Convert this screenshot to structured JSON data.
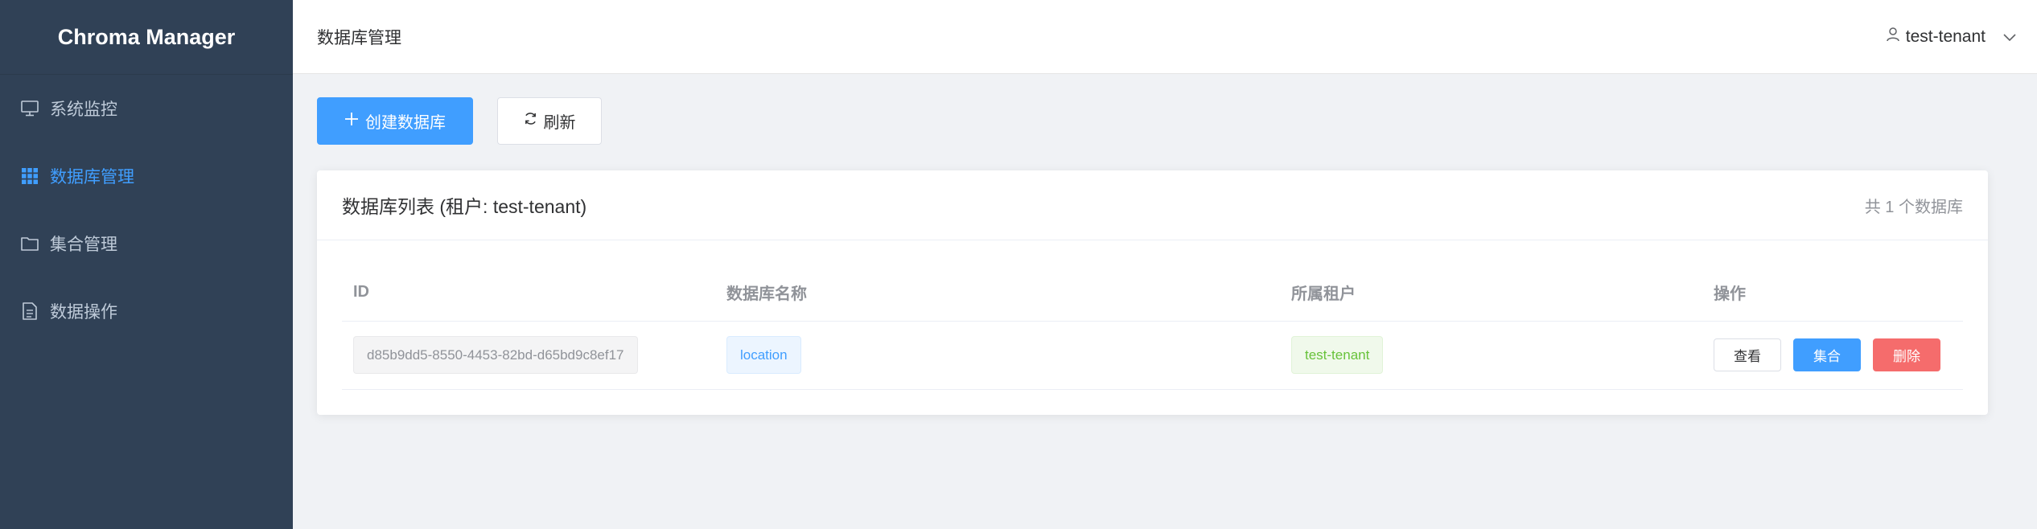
{
  "sidebar": {
    "brand": "Chroma Manager",
    "items": [
      {
        "label": "系统监控",
        "icon": "monitor-icon",
        "active": false
      },
      {
        "label": "数据库管理",
        "icon": "grid-icon",
        "active": true
      },
      {
        "label": "集合管理",
        "icon": "folder-icon",
        "active": false
      },
      {
        "label": "数据操作",
        "icon": "document-icon",
        "active": false
      }
    ]
  },
  "header": {
    "title": "数据库管理",
    "user": "test-tenant",
    "user_icon": "user-icon",
    "dropdown_icon": "chevron-down-icon"
  },
  "toolbar": {
    "create_label": "创建数据库",
    "create_icon": "plus-icon",
    "refresh_label": "刷新",
    "refresh_icon": "refresh-icon"
  },
  "card": {
    "title": "数据库列表 (租户: test-tenant)",
    "count": "共 1 个数据库"
  },
  "table": {
    "columns": [
      "ID",
      "数据库名称",
      "所属租户",
      "操作"
    ],
    "rows": [
      {
        "id": "d85b9dd5-8550-4453-82bd-d65bd9c8ef17",
        "name": "location",
        "tenant": "test-tenant",
        "actions": {
          "view": "查看",
          "collections": "集合",
          "delete": "删除"
        }
      }
    ]
  },
  "colors": {
    "sidebar_bg": "#304156",
    "accent": "#409eff",
    "success": "#67c23a",
    "danger": "#f56c6c"
  }
}
